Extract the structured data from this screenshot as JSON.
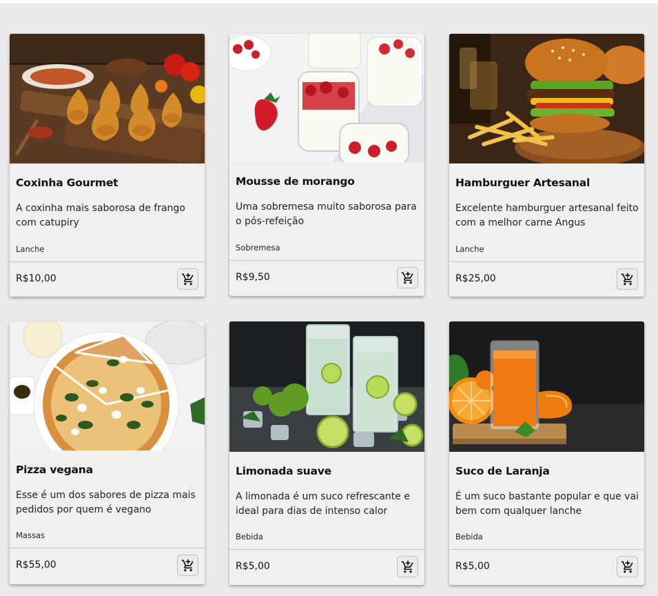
{
  "products": [
    {
      "name": "Coxinha Gourmet",
      "description": "A coxinha mais saborosa de frango com catupiry",
      "category": "Lanche",
      "price": "R$10,00",
      "image_icon": "coxinha-photo",
      "cart_icon": "add-to-cart-icon"
    },
    {
      "name": "Mousse de morango",
      "description": "Uma sobremesa muito saborosa para o pós-refeição",
      "category": "Sobremesa",
      "price": "R$9,50",
      "image_icon": "strawberry-mousse-photo",
      "cart_icon": "add-to-cart-icon"
    },
    {
      "name": "Hamburguer Artesanal",
      "description": "Excelente hamburguer artesanal feito com a melhor carne Angus",
      "category": "Lanche",
      "price": "R$25,00",
      "image_icon": "burger-photo",
      "cart_icon": "add-to-cart-icon"
    },
    {
      "name": "Pizza vegana",
      "description": "Esse é um dos sabores de pizza mais pedidos por quem é vegano",
      "category": "Massas",
      "price": "R$55,00",
      "image_icon": "pizza-photo",
      "cart_icon": "add-to-cart-icon"
    },
    {
      "name": "Limonada suave",
      "description": "A limonada é um suco refrescante e ideal para dias de intenso calor",
      "category": "Bebida",
      "price": "R$5,00",
      "image_icon": "lemonade-photo",
      "cart_icon": "add-to-cart-icon"
    },
    {
      "name": "Suco de Laranja",
      "description": "É um suco bastante popular e que vai bem com qualquer lanche",
      "category": "Bebida",
      "price": "R$5,00",
      "image_icon": "orange-juice-photo",
      "cart_icon": "add-to-cart-icon"
    }
  ],
  "colors": {
    "page_bg": "#ebebeb",
    "card_bg": "#f0f0f0",
    "divider": "#c9c9c9"
  }
}
